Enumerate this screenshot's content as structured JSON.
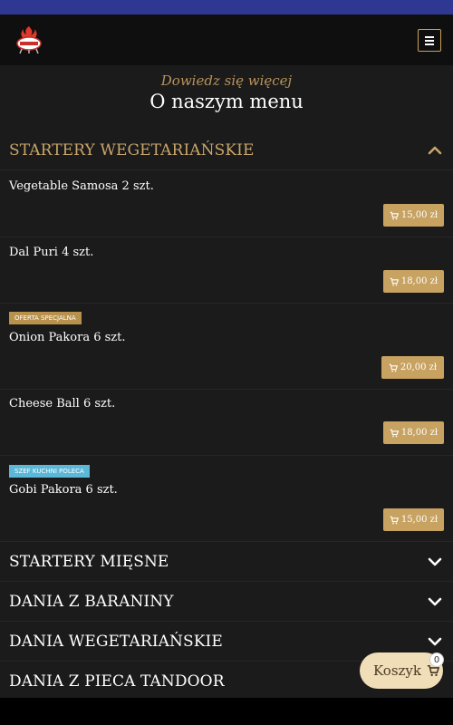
{
  "header": {
    "logo_icon": "grill-logo",
    "menu_icon": "hamburger-menu-icon",
    "accent_color": "#c9a35c"
  },
  "intro": {
    "subtitle": "Dowiedz się więcej",
    "title": "O naszym menu"
  },
  "categories": [
    {
      "label": "STARTERY WEGETARIAŃSKIE",
      "expanded": true
    },
    {
      "label": "STARTERY MIĘSNE",
      "expanded": false
    },
    {
      "label": "DANIA Z BARANINY",
      "expanded": false
    },
    {
      "label": "DANIA WEGETARIAŃSKIE",
      "expanded": false
    },
    {
      "label": "DANIA Z PIECA TANDOOR",
      "expanded": false
    }
  ],
  "items": [
    {
      "name": "Vegetable Samosa 2 szt.",
      "price": "15,00 zł",
      "badge": ""
    },
    {
      "name": "Dal Puri 4 szt.",
      "price": "18,00 zł",
      "badge": ""
    },
    {
      "name": "Onion Pakora 6 szt.",
      "price": "20,00 zł",
      "badge": "OFERTA SPECJALNA"
    },
    {
      "name": "Cheese Ball 6 szt.",
      "price": "18,00 zł",
      "badge": ""
    },
    {
      "name": "Gobi Pakora 6 szt.",
      "price": "15,00 zł",
      "badge": "SZEF KUCHNI POLECA"
    }
  ],
  "cart": {
    "label": "Koszyk",
    "count": "0",
    "icon": "shopping-cart-icon"
  }
}
